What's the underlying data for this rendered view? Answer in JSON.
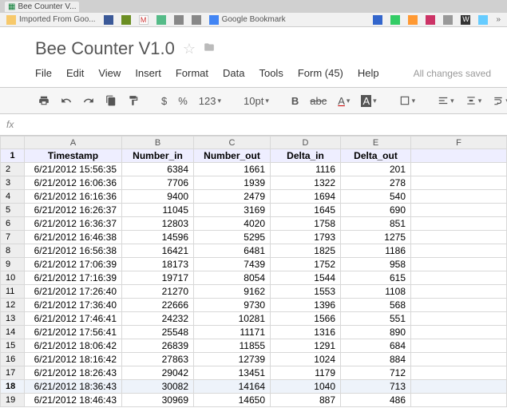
{
  "browser": {
    "tab_label": "Bee Counter V..."
  },
  "bookmarks": {
    "item1": "Imported From Goo...",
    "item2": "Google Bookmark"
  },
  "doc": {
    "title": "Bee Counter V1.0",
    "menus": {
      "file": "File",
      "edit": "Edit",
      "view": "View",
      "insert": "Insert",
      "format": "Format",
      "data": "Data",
      "tools": "Tools",
      "form": "Form (45)",
      "help": "Help"
    },
    "status": "All changes saved"
  },
  "toolbar": {
    "currency": "$",
    "percent": "%",
    "numfmt": "123",
    "fontsize": "10pt",
    "bold": "B",
    "strike": "abc",
    "textcolor": "A",
    "fillcolor": "A"
  },
  "fx": {
    "label": "fx"
  },
  "columns": [
    "A",
    "B",
    "C",
    "D",
    "E",
    "F"
  ],
  "headers": [
    "Timestamp",
    "Number_in",
    "Number_out",
    "Delta_in",
    "Delta_out"
  ],
  "rows": [
    [
      "6/21/2012 15:56:35",
      "6384",
      "1661",
      "1116",
      "201"
    ],
    [
      "6/21/2012 16:06:36",
      "7706",
      "1939",
      "1322",
      "278"
    ],
    [
      "6/21/2012 16:16:36",
      "9400",
      "2479",
      "1694",
      "540"
    ],
    [
      "6/21/2012 16:26:37",
      "11045",
      "3169",
      "1645",
      "690"
    ],
    [
      "6/21/2012 16:36:37",
      "12803",
      "4020",
      "1758",
      "851"
    ],
    [
      "6/21/2012 16:46:38",
      "14596",
      "5295",
      "1793",
      "1275"
    ],
    [
      "6/21/2012 16:56:38",
      "16421",
      "6481",
      "1825",
      "1186"
    ],
    [
      "6/21/2012 17:06:39",
      "18173",
      "7439",
      "1752",
      "958"
    ],
    [
      "6/21/2012 17:16:39",
      "19717",
      "8054",
      "1544",
      "615"
    ],
    [
      "6/21/2012 17:26:40",
      "21270",
      "9162",
      "1553",
      "1108"
    ],
    [
      "6/21/2012 17:36:40",
      "22666",
      "9730",
      "1396",
      "568"
    ],
    [
      "6/21/2012 17:46:41",
      "24232",
      "10281",
      "1566",
      "551"
    ],
    [
      "6/21/2012 17:56:41",
      "25548",
      "11171",
      "1316",
      "890"
    ],
    [
      "6/21/2012 18:06:42",
      "26839",
      "11855",
      "1291",
      "684"
    ],
    [
      "6/21/2012 18:16:42",
      "27863",
      "12739",
      "1024",
      "884"
    ],
    [
      "6/21/2012 18:26:43",
      "29042",
      "13451",
      "1179",
      "712"
    ],
    [
      "6/21/2012 18:36:43",
      "30082",
      "14164",
      "1040",
      "713"
    ],
    [
      "6/21/2012 18:46:43",
      "30969",
      "14650",
      "887",
      "486"
    ]
  ],
  "chart_data": {
    "type": "table",
    "title": "Bee Counter V1.0",
    "columns": [
      "Timestamp",
      "Number_in",
      "Number_out",
      "Delta_in",
      "Delta_out"
    ],
    "series": [
      {
        "name": "Number_in",
        "values": [
          6384,
          7706,
          9400,
          11045,
          12803,
          14596,
          16421,
          18173,
          19717,
          21270,
          22666,
          24232,
          25548,
          26839,
          27863,
          29042,
          30082,
          30969
        ]
      },
      {
        "name": "Number_out",
        "values": [
          1661,
          1939,
          2479,
          3169,
          4020,
          5295,
          6481,
          7439,
          8054,
          9162,
          9730,
          10281,
          11171,
          11855,
          12739,
          13451,
          14164,
          14650
        ]
      },
      {
        "name": "Delta_in",
        "values": [
          1116,
          1322,
          1694,
          1645,
          1758,
          1793,
          1825,
          1752,
          1544,
          1553,
          1396,
          1566,
          1316,
          1291,
          1024,
          1179,
          1040,
          887
        ]
      },
      {
        "name": "Delta_out",
        "values": [
          201,
          278,
          540,
          690,
          851,
          1275,
          1186,
          958,
          615,
          1108,
          568,
          551,
          890,
          684,
          884,
          712,
          713,
          486
        ]
      }
    ],
    "categories": [
      "6/21/2012 15:56:35",
      "6/21/2012 16:06:36",
      "6/21/2012 16:16:36",
      "6/21/2012 16:26:37",
      "6/21/2012 16:36:37",
      "6/21/2012 16:46:38",
      "6/21/2012 16:56:38",
      "6/21/2012 17:06:39",
      "6/21/2012 17:16:39",
      "6/21/2012 17:26:40",
      "6/21/2012 17:36:40",
      "6/21/2012 17:46:41",
      "6/21/2012 17:56:41",
      "6/21/2012 18:06:42",
      "6/21/2012 18:16:42",
      "6/21/2012 18:26:43",
      "6/21/2012 18:36:43",
      "6/21/2012 18:46:43"
    ]
  }
}
